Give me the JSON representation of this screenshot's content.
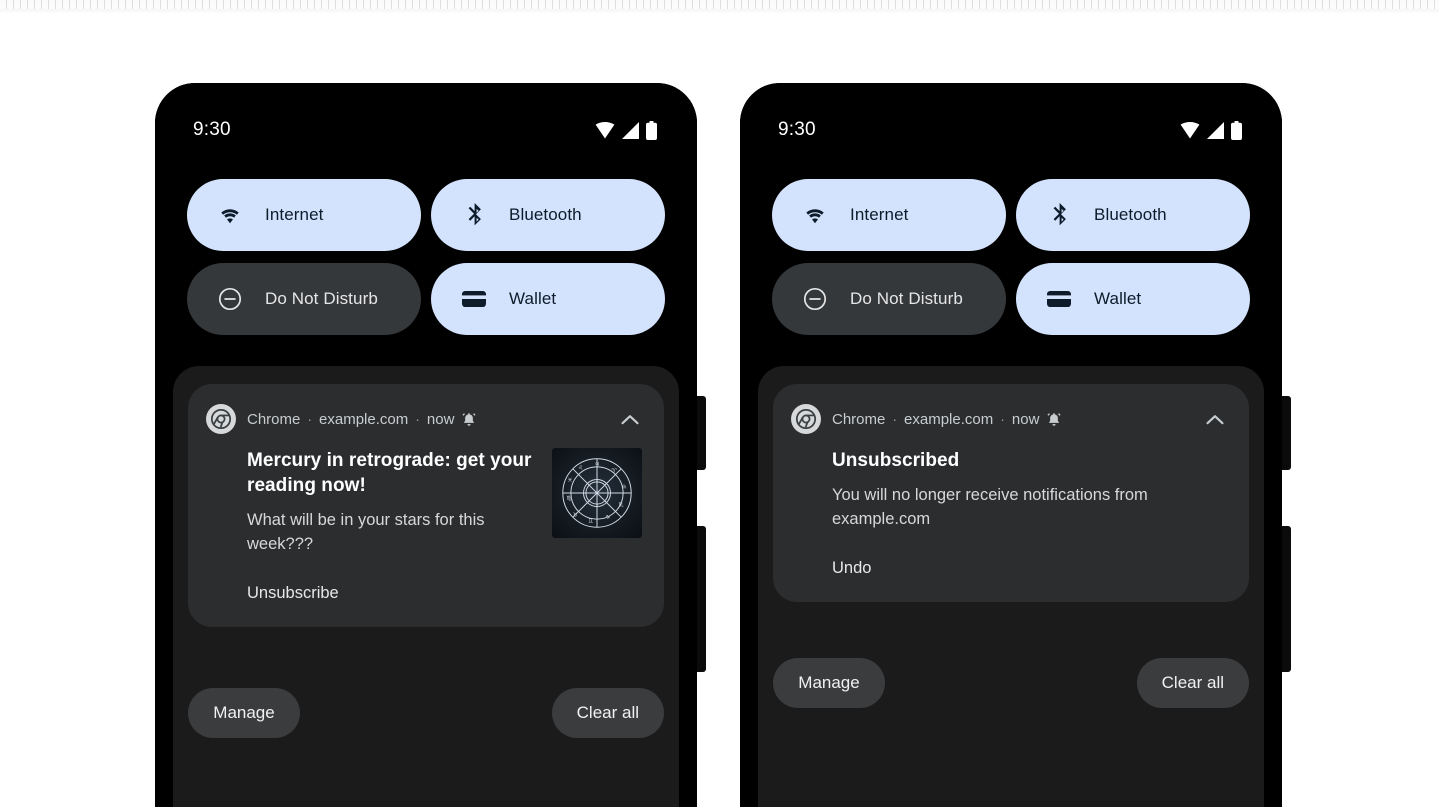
{
  "statusbar": {
    "time": "9:30",
    "icons": [
      "wifi-icon",
      "cell-signal-icon",
      "battery-icon"
    ]
  },
  "quick_settings": {
    "tiles": [
      {
        "label": "Internet",
        "icon": "wifi-icon",
        "state": "on"
      },
      {
        "label": "Bluetooth",
        "icon": "bluetooth-icon",
        "state": "on"
      },
      {
        "label": "Do Not Disturb",
        "icon": "do-not-disturb-icon",
        "state": "off"
      },
      {
        "label": "Wallet",
        "icon": "wallet-icon",
        "state": "on"
      }
    ],
    "colors": {
      "on_bg": "#d4e3fd",
      "on_fg": "#0d1b2a",
      "off_bg": "#35383b",
      "off_fg": "#e6e6e6"
    }
  },
  "phones": [
    {
      "id": "before",
      "notification": {
        "app": "Chrome",
        "source": "example.com",
        "time": "now",
        "separator": "·",
        "alert_icon": "bell-icon",
        "collapse_icon": "chevron-up-icon",
        "title": "Mercury in retrograde: get your reading now!",
        "description": "What will be in your stars for this week???",
        "action": "Unsubscribe",
        "thumbnail": "zodiac-wheel-image"
      },
      "actions": {
        "manage": "Manage",
        "clear": "Clear all"
      }
    },
    {
      "id": "after",
      "notification": {
        "app": "Chrome",
        "source": "example.com",
        "time": "now",
        "separator": "·",
        "alert_icon": "bell-icon",
        "collapse_icon": "chevron-up-icon",
        "title": "Unsubscribed",
        "description": "You will no longer receive notifications from example.com",
        "action": "Undo",
        "thumbnail": null
      },
      "actions": {
        "manage": "Manage",
        "clear": "Clear all"
      }
    }
  ],
  "theme": {
    "page_bg": "#ffffff",
    "phone_bg": "#000000",
    "shade_bg": "#1b1b1b",
    "card_bg": "#2b2d2f",
    "pill_bg": "#3a3c3e",
    "text_primary": "#ffffff",
    "text_secondary": "#d6d8da"
  }
}
